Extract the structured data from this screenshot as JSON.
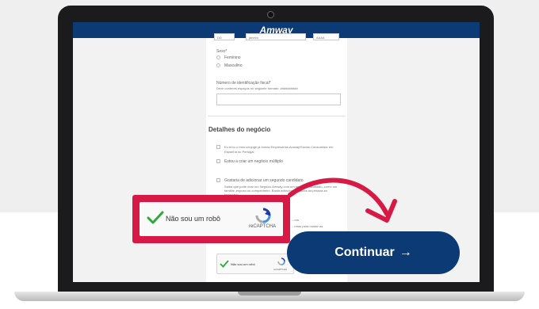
{
  "brand": {
    "logo_text": "Amway"
  },
  "form": {
    "dob_fields": [
      "DD",
      "janeiro",
      "AAAA"
    ],
    "sex_label": "Sexo*",
    "sex_options": [
      "Feminino",
      "Masculino"
    ],
    "tax_id_label": "Número de identificação fiscal*",
    "tax_id_hint": "Deve conteres espaços no seguinte formato: ##########",
    "tax_id_value": ""
  },
  "business": {
    "title": "Detalhes do negócio",
    "options": [
      "Eu e/ou o meu cônjuge já fomos Empresários Amway/Sócios Consumidor em Espanha ou Portugal",
      "Estou a criar um negócio múltiplo",
      "Gostaria de adicionar um segundo candidato"
    ],
    "second_candidate_note": "Saiba que pode criar um Negócio Amway com um segundo candidato, como um familiar, esposo ou companheiro. Basta adicionar os dados da pessoa ao formulário.",
    "extra_note": "...ma",
    "extra_note_2": "...rmas para mudar as"
  },
  "recaptcha": {
    "label": "Não sou um robô",
    "footer": "reCAPTCHA",
    "checked": true
  },
  "cta": {
    "label": "Continuar",
    "arrow": "→"
  },
  "colors": {
    "navy": "#0b3a75",
    "highlight": "#d71a45",
    "check_green": "#2fa93a"
  }
}
